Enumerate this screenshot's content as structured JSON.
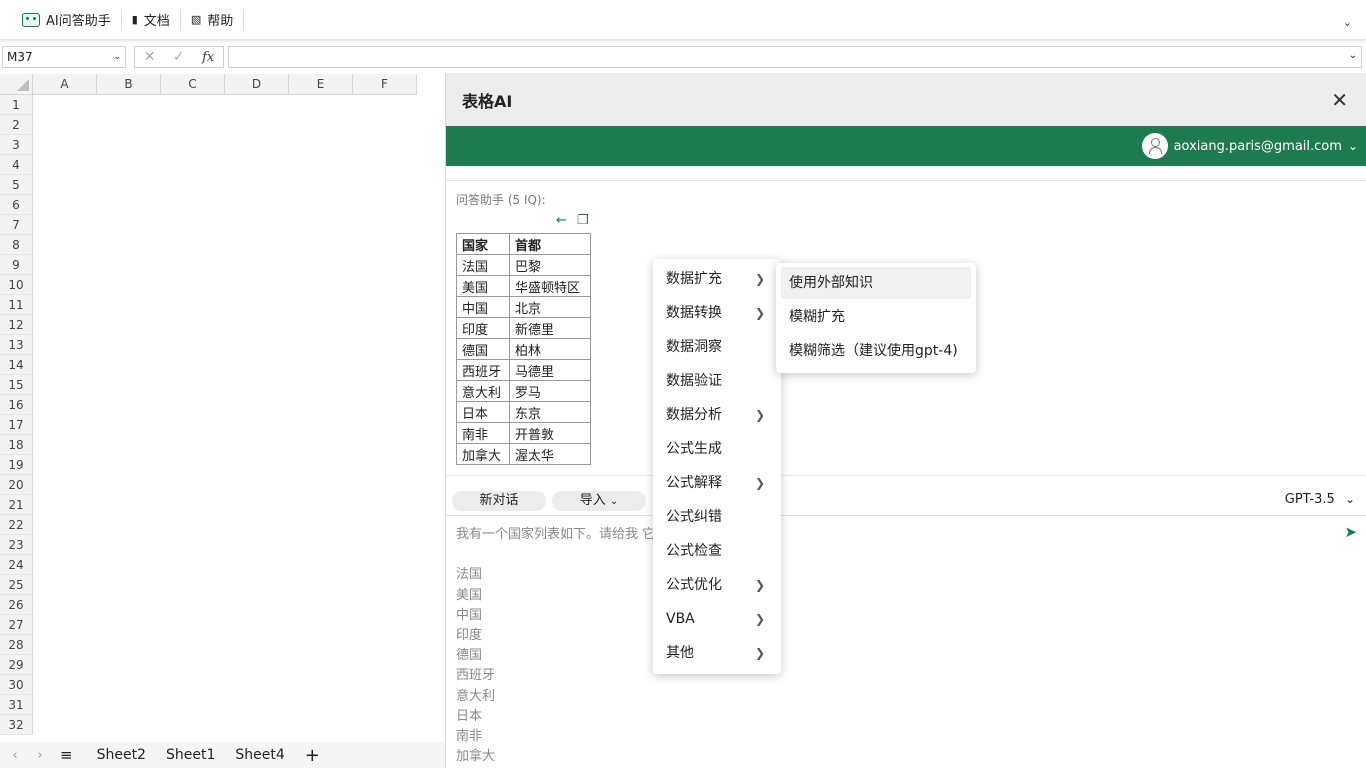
{
  "ribbon": {
    "ai_assistant": "AI问答助手",
    "docs": "文档",
    "help": "帮助"
  },
  "formula_bar": {
    "cell_ref": "M37",
    "formula": ""
  },
  "grid": {
    "columns": [
      "A",
      "B",
      "C",
      "D",
      "E",
      "F"
    ],
    "rows": [
      "1",
      "2",
      "3",
      "4",
      "5",
      "6",
      "7",
      "8",
      "9",
      "10",
      "11",
      "12",
      "13",
      "14",
      "15",
      "16",
      "17",
      "18",
      "19",
      "20",
      "21",
      "22",
      "23",
      "24",
      "25",
      "26",
      "27",
      "28",
      "29",
      "30",
      "31",
      "32"
    ]
  },
  "sheets": [
    "Sheet2",
    "Sheet1",
    "Sheet4"
  ],
  "panel": {
    "title": "表格AI",
    "user_email": "aoxiang.paris@gmail.com",
    "chat_label": "问答助手 (5 IQ):",
    "table_headers": [
      "国家",
      "首都"
    ],
    "table_rows": [
      [
        "法国",
        "巴黎"
      ],
      [
        "美国",
        "华盛顿特区"
      ],
      [
        "中国",
        "北京"
      ],
      [
        "印度",
        "新德里"
      ],
      [
        "德国",
        "柏林"
      ],
      [
        "西班牙",
        "马德里"
      ],
      [
        "意大利",
        "罗马"
      ],
      [
        "日本",
        "东京"
      ],
      [
        "南非",
        "开普敦"
      ],
      [
        "加拿大",
        "渥太华"
      ]
    ],
    "new_chat": "新对话",
    "import": "导入",
    "model": "GPT-3.5",
    "prompt_text": "我有一个国家列表如下。请给我                                              它们的首都。\n\n法国\n美国\n中国\n印度\n德国\n西班牙\n意大利\n日本\n南非\n加拿大"
  },
  "context_menu": [
    {
      "label": "数据扩充",
      "submenu": true
    },
    {
      "label": "数据转换",
      "submenu": true
    },
    {
      "label": "数据洞察",
      "submenu": false
    },
    {
      "label": "数据验证",
      "submenu": false
    },
    {
      "label": "数据分析",
      "submenu": true
    },
    {
      "label": "公式生成",
      "submenu": false
    },
    {
      "label": "公式解释",
      "submenu": true
    },
    {
      "label": "公式纠错",
      "submenu": false
    },
    {
      "label": "公式检查",
      "submenu": false
    },
    {
      "label": "公式优化",
      "submenu": true
    },
    {
      "label": "VBA",
      "submenu": true
    },
    {
      "label": "其他",
      "submenu": true
    }
  ],
  "submenu": [
    "使用外部知识",
    "模糊扩充",
    "模糊筛选（建议使用gpt-4)"
  ],
  "colors": {
    "accent_green": "#1e7a4f",
    "panel_header": "#ececec"
  }
}
